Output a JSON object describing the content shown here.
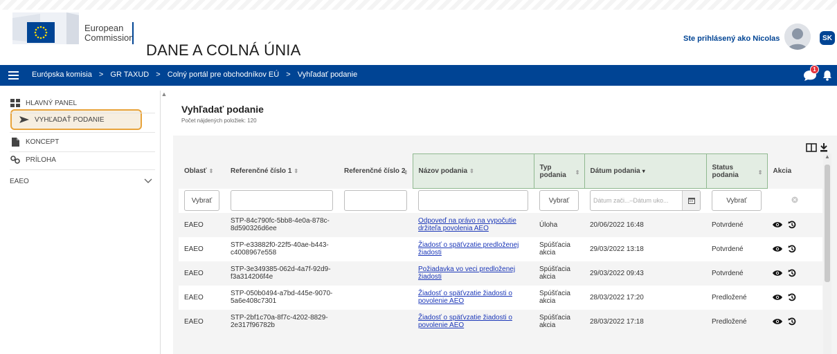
{
  "header": {
    "logo_line1": "European",
    "logo_line2": "Commission",
    "site_title": "DANE A COLNÁ ÚNIA",
    "logged_in_text": "Ste prihlásený ako Nicolas",
    "language": "SK"
  },
  "navbar": {
    "breadcrumbs": [
      "Európska komisia",
      ">",
      "GR TAXUD",
      ">",
      "Colný portál pre obchodníkov EÚ",
      ">",
      "Vyhľadať podanie"
    ],
    "notifications_count": "1",
    "icons": {
      "menu": "hamburger-icon",
      "chat": "chat-icon",
      "bell": "bell-icon"
    }
  },
  "sidebar": {
    "items": [
      {
        "label": "HLAVNÝ PANEL",
        "icon": "dashboard-icon"
      },
      {
        "label": "VYHĽADAŤ PODANIE",
        "icon": "arrow-right-icon",
        "active": true
      },
      {
        "label": "KONCEPT",
        "icon": "document-icon"
      },
      {
        "label": "PRÍLOHA",
        "icon": "link-icon"
      },
      {
        "label": "EAEO",
        "icon": "chevron-down-icon"
      }
    ],
    "highlight_color": "#e8a33a"
  },
  "main": {
    "title": "Vyhľadať podanie",
    "count_text": "Počet nájdených položiek: 120",
    "columns": [
      {
        "label": "Oblasť",
        "sort": "⇕"
      },
      {
        "label": "Referenčné číslo 1",
        "sort": "⇕"
      },
      {
        "label": "Referenčné číslo 2",
        "sort": "⇕"
      },
      {
        "label": "Názov podania",
        "sort": "⇕"
      },
      {
        "label": "Typ podania",
        "sort": "⇕"
      },
      {
        "label": "Dátum podania",
        "sort": "▾"
      },
      {
        "label": "Status podania",
        "sort": "⇕"
      },
      {
        "label": "Akcia",
        "sort": ""
      }
    ],
    "filters": {
      "area_button": "Vybrať",
      "type_button": "Vybrať",
      "status_button": "Vybrať",
      "date_from_placeholder": "Dátum zači...",
      "date_to_placeholder": "–Dátum uko..."
    },
    "rows": [
      {
        "area": "EAEO",
        "ref1": "STP-84c790fc-5bb8-4e0a-878c-8d590326d6ee",
        "ref2": "",
        "name": "Odpoveď na právo na vypočutie držiteľa povolenia AEO",
        "type": "Úloha",
        "date": "20/06/2022 16:48",
        "status": "Potvrdené"
      },
      {
        "area": "EAEO",
        "ref1": "STP-e33882f0-22f5-40ae-b443-c4008967e558",
        "ref2": "",
        "name": "Žiadosť o späťvzatie predloženej žiadosti",
        "type": "Spúšťacia akcia",
        "date": "29/03/2022 13:18",
        "status": "Potvrdené"
      },
      {
        "area": "EAEO",
        "ref1": "STP-3e349385-062d-4a7f-92d9-f3a314206f4e",
        "ref2": "",
        "name": "Požiadavka vo veci predloženej žiadosti",
        "type": "Spúšťacia akcia",
        "date": "29/03/2022 09:43",
        "status": "Potvrdené"
      },
      {
        "area": "EAEO",
        "ref1": "STP-050b0494-a7bd-445e-9070-5a6e408c7301",
        "ref2": "",
        "name": "Žiadosť o späťvzatie žiadosti o povolenie AEO",
        "type": "Spúšťacia akcia",
        "date": "28/03/2022 17:20",
        "status": "Predložené"
      },
      {
        "area": "EAEO",
        "ref1": "STP-2bf1c70a-8f7c-4202-8829-2e317f96782b",
        "ref2": "",
        "name": "Žiadosť o späťvzatie žiadosti o povolenie AEO",
        "type": "Spúšťacia akcia",
        "date": "28/03/2022 17:18",
        "status": "Predložené"
      }
    ],
    "row_icons": [
      "eye-icon",
      "history-icon"
    ],
    "colors": {
      "brand_blue": "#004494",
      "link": "#1b37b8",
      "highlight_header": "#e3ede3",
      "badge_red": "#e4303a"
    }
  }
}
